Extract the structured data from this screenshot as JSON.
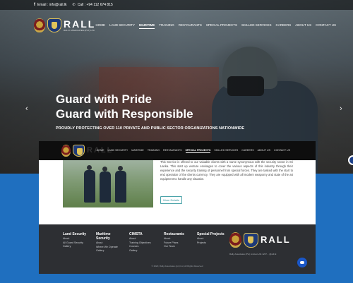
{
  "topbar": {
    "email": "Email : info@rall.lk",
    "call": "Call : +94 112 674 815"
  },
  "brand": {
    "name": "RALL",
    "tagline": "RALLY ASSOCIATES (PVT) LTD"
  },
  "nav": {
    "items": [
      "HOME",
      "LAND SECURITY",
      "MARITIME",
      "TRAINING",
      "RESTAURANTS",
      "SPECIAL PROJECTS",
      "SKILLED SERVICES",
      "CAREERS",
      "ABOUT US",
      "CONTACT US"
    ],
    "active": "MARITIME"
  },
  "hero": {
    "line1": "Guard with Pride",
    "line2": "Guard with Responsible",
    "tagline": "PROUDLY PROTECTING OVER 110 PRIVATE AND PUBLIC SECTOR ORGANIZATIONS NATIONWIDE",
    "prev_icon": "chevron-left-icon",
    "next_icon": "chevron-right-icon"
  },
  "window": {
    "nav": {
      "items": [
        "HOME",
        "LAND SECURITY",
        "MARITIME",
        "TRAINING",
        "RESTAURANTS",
        "SPECIAL PROJECTS",
        "SKILLED SERVICES",
        "CAREERS",
        "ABOUT US",
        "CONTACT US"
      ],
      "active": "SPECIAL PROJECTS"
    },
    "description": "This Service is offered to our valuable clients with a name synonymous with the security sector in Sri Lanka. This start up venture envisages to cover the various aspects of this industry through their experience and the security training of personnel from special forces. They are tasked with the start to end operation of the clients currency. They are equipped with all modern weaponry and state of the art equipment to handle any situation.",
    "more_details": "More Details"
  },
  "footer": {
    "columns": [
      {
        "heading": "Land Security",
        "links": [
          "About",
          "All Guard Security",
          "Gallery"
        ]
      },
      {
        "heading": "Maritime Security",
        "links": [
          "About",
          "Where We Operate",
          "Gallery"
        ]
      },
      {
        "heading": "CIMSTA",
        "links": [
          "About",
          "Training Objectives",
          "Courses",
          "Gallery"
        ]
      },
      {
        "heading": "Restaurants",
        "links": [
          "About",
          "Future Plans",
          "Our Team"
        ]
      },
      {
        "heading": "Special Projects",
        "links": [
          "About",
          "Projects"
        ]
      }
    ],
    "contact": "Rally Associates (Pvt) Limited +94 1267... @rall.lk",
    "copyright": "© 2020, Rally Associates (pvt) Ltd, All Rights Reserved"
  },
  "colors": {
    "band": "#1f6fbf",
    "footer": "#2d2f33",
    "accent": "#4aa3a9"
  }
}
